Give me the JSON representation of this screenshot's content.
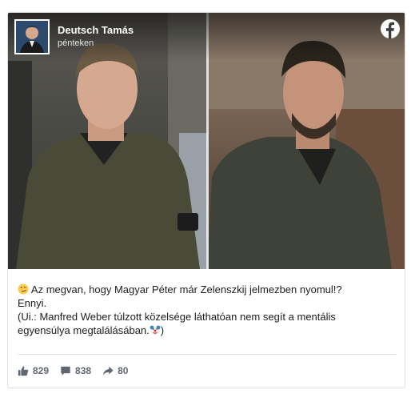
{
  "post": {
    "author": "Deutsch Tamás",
    "time": "pénteken",
    "line1": "Az megvan, hogy Magyar Péter már Zelenszkij jelmezben nyomul!?",
    "line2": "Ennyi.",
    "line3": "(Ui.: Manfred Weber túlzott közelsége láthatóan nem segít a mentális",
    "line4_text": "egyensúlya megtalálásában.",
    "line4_end": ")"
  },
  "stats": {
    "likes": "829",
    "comments": "838",
    "shares": "80"
  },
  "icons": {
    "platform": "facebook-icon",
    "emoji_start": "smirk-emoji-icon",
    "emoji_end": "clown-emoji-icon",
    "like": "thumbs-up-icon",
    "comment": "comment-icon",
    "share": "share-arrow-icon"
  },
  "colors": {
    "text": "#1c1e21",
    "meta": "#606770",
    "border": "#dddfe2"
  }
}
